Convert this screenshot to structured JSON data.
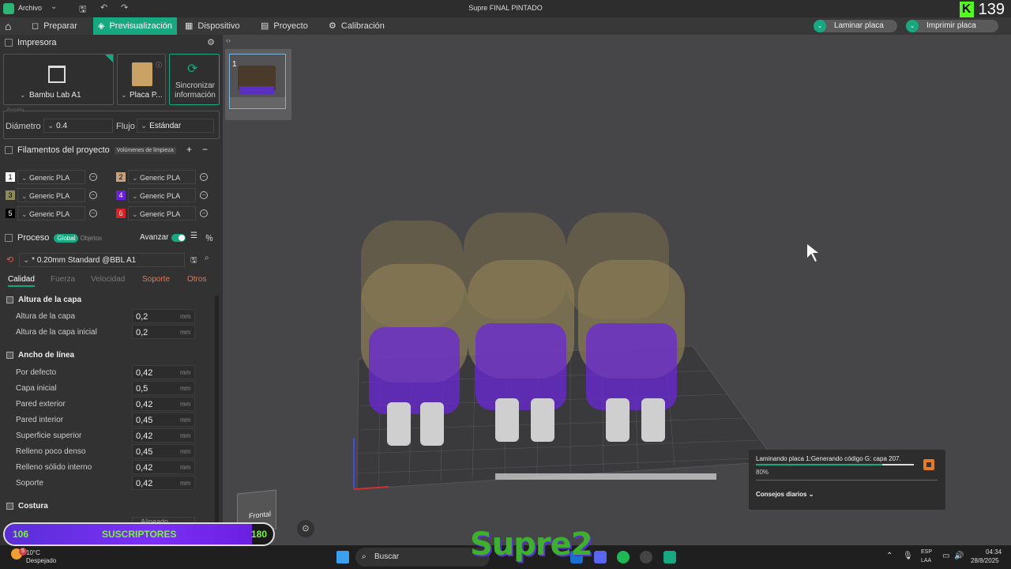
{
  "titlebar": {
    "menu": "Archivo",
    "title": "Supre FINAL PINTADO",
    "kick_count": "139"
  },
  "nav": {
    "prepare": "Preparar",
    "preview": "Previsualización",
    "device": "Dispositivo",
    "project": "Proyecto",
    "calibration": "Calibración",
    "slice_btn": "Laminar placa",
    "print_btn": "Imprimir placa"
  },
  "printer": {
    "section": "Impresora",
    "name": "Bambu Lab A1",
    "plate": "Placa P...",
    "sync": "Sincronizar información",
    "nozzle_label": "Boquilla",
    "diameter_label": "Diámetro",
    "diameter_value": "0.4",
    "flow_label": "Flujo",
    "flow_value": "Estándar"
  },
  "filaments": {
    "section": "Filamentos del proyecto",
    "purge_btn": "Volúmenes de limpieza",
    "items": [
      {
        "num": "1",
        "name": "Generic PLA",
        "color": "#ffffff",
        "text": "#000000"
      },
      {
        "num": "2",
        "name": "Generic PLA",
        "color": "#c8a07a",
        "text": "#000000"
      },
      {
        "num": "3",
        "name": "Generic PLA",
        "color": "#8a8a5a",
        "text": "#000000"
      },
      {
        "num": "4",
        "name": "Generic PLA",
        "color": "#6a1fe0",
        "text": "#ffffff"
      },
      {
        "num": "5",
        "name": "Generic PLA",
        "color": "#000000",
        "text": "#ffffff"
      },
      {
        "num": "6",
        "name": "Generic PLA",
        "color": "#e02020",
        "text": "#ffffff"
      }
    ]
  },
  "process": {
    "section": "Proceso",
    "global": "Global",
    "objects": "Objetos",
    "advanced": "Avanzar",
    "profile": "* 0.20mm Standard @BBL A1",
    "tabs": [
      "Calidad",
      "Fuerza",
      "Velocidad",
      "Soporte",
      "Otros"
    ],
    "layer_height_group": "Altura de la capa",
    "layer_params": [
      {
        "label": "Altura de la capa",
        "value": "0,2",
        "unit": "mm"
      },
      {
        "label": "Altura de la capa inicial",
        "value": "0,2",
        "unit": "mm"
      }
    ],
    "line_width_group": "Ancho de línea",
    "line_params": [
      {
        "label": "Por defecto",
        "value": "0,42",
        "unit": "mm"
      },
      {
        "label": "Capa inicial",
        "value": "0,5",
        "unit": "mm"
      },
      {
        "label": "Pared exterior",
        "value": "0,42",
        "unit": "mm"
      },
      {
        "label": "Pared interior",
        "value": "0,45",
        "unit": "mm"
      },
      {
        "label": "Superficie superior",
        "value": "0,42",
        "unit": "mm"
      },
      {
        "label": "Relleno poco denso",
        "value": "0,45",
        "unit": "mm"
      },
      {
        "label": "Relleno sólido interno",
        "value": "0,42",
        "unit": "mm"
      },
      {
        "label": "Soporte",
        "value": "0,42",
        "unit": "mm"
      }
    ],
    "seam_group": "Costura",
    "seam_value": "Alineado"
  },
  "viewport": {
    "plate_num": "1",
    "view_label": "Frontal",
    "progress_text": "Laminando placa 1:Generando código G: capa 207.",
    "progress_pct": "80%",
    "progress_value": 0.8,
    "tips": "Consejos diarios"
  },
  "overlay": {
    "sub_start": "106",
    "sub_label": "SUSCRIPTORES",
    "sub_end": "180",
    "sub_fraction": 0.92,
    "logo_text": "Supre2"
  },
  "taskbar": {
    "weather_temp": "10°C",
    "weather_desc": "Despejado",
    "weather_badge": "5",
    "search": "Buscar",
    "lang1": "ESP",
    "lang2": "LAA",
    "time": "04:34",
    "date": "28/8/2025"
  },
  "colors": {
    "accent": "#16a87e",
    "purple": "#6a1fe0",
    "green_neon": "#53fc18"
  }
}
